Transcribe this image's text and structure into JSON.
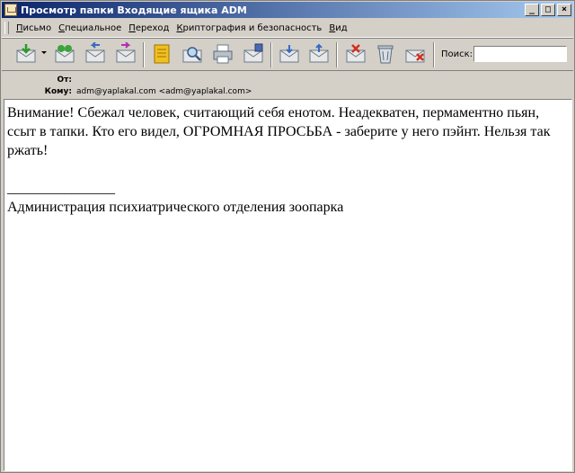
{
  "window": {
    "title": "Просмотр папки Входящие ящика ADM",
    "buttons": {
      "minimize": "_",
      "maximize": "□",
      "close": "×"
    }
  },
  "menu": {
    "items": [
      {
        "key": "П",
        "rest": "исьмо"
      },
      {
        "key": "С",
        "rest": "пециальное"
      },
      {
        "key": "П",
        "rest": "ереход"
      },
      {
        "key": "К",
        "rest": "риптография и безопасность"
      },
      {
        "key": "В",
        "rest": "ид"
      }
    ]
  },
  "toolbar": {
    "icons": [
      "new-mail-icon",
      "address-book-icon",
      "reply-icon",
      "forward-icon",
      "notepad-icon",
      "search-mail-icon",
      "print-icon",
      "compose-icon",
      "inbox-icon",
      "outbox-icon",
      "mark-read-icon",
      "delete-icon",
      "junk-icon"
    ],
    "search_label": "Поиск:",
    "search_value": ""
  },
  "headers": {
    "from_label": "От:",
    "from_value": "",
    "to_label": "Кому:",
    "to_value": "adm@yaplakal.com <adm@yaplakal.com>"
  },
  "message": {
    "body": "Внимание! Сбежал человек, считающий себя енотом. Неадекватен, пермаментно пьян, ссыт в тапки. Кто его видел, ОГРОМНАЯ ПРОСЬБА - заберите у него пэйнт. Нельзя так ржать!",
    "separator": "_______________",
    "signature": "Администрация психиатрического отделения зоопарка"
  },
  "colors": {
    "titlebar_start": "#0a246a",
    "titlebar_end": "#a6caf0",
    "chrome": "#d4d0c8"
  }
}
